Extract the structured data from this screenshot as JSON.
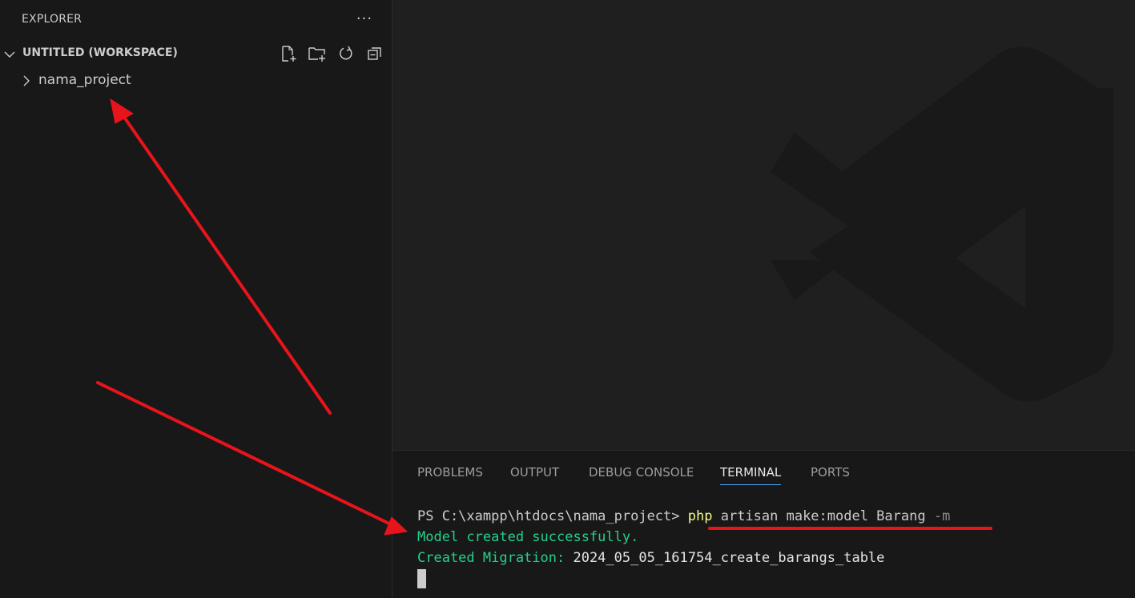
{
  "explorer": {
    "title": "EXPLORER",
    "more_label": "···",
    "workspace": {
      "title": "UNTITLED (WORKSPACE)",
      "actions": [
        "new-file-icon",
        "new-folder-icon",
        "refresh-icon",
        "collapse-all-icon"
      ]
    },
    "items": [
      {
        "label": "nama_project",
        "expanded": false
      }
    ]
  },
  "panel": {
    "tabs": [
      {
        "label": "PROBLEMS",
        "active": false
      },
      {
        "label": "OUTPUT",
        "active": false
      },
      {
        "label": "DEBUG CONSOLE",
        "active": false
      },
      {
        "label": "TERMINAL",
        "active": true
      },
      {
        "label": "PORTS",
        "active": false
      }
    ],
    "terminal": {
      "prompt": "PS C:\\xampp\\htdocs\\nama_project> ",
      "cmd_php": "php",
      "cmd_rest": " artisan make:model Barang ",
      "cmd_flag": "-m",
      "line2": "Model created successfully.",
      "line3_label": "Created Migration: ",
      "line3_value": "2024_05_05_161754_create_barangs_table"
    }
  },
  "colors": {
    "annotation": "#e8141b",
    "terminal_green": "#23d18b",
    "php_yellow": "#f1fa8c",
    "active_tab_underline": "#4daafc"
  }
}
